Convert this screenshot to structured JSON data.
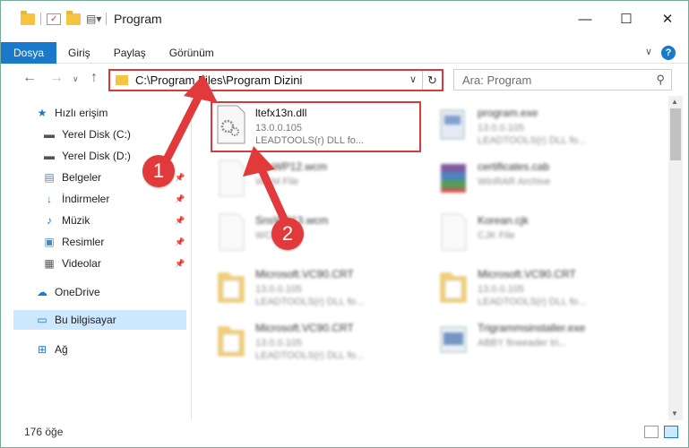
{
  "window": {
    "title": "Program",
    "controls": {
      "minimize": "—",
      "maximize": "☐",
      "close": "✕"
    }
  },
  "ribbon": {
    "tabs": [
      "Dosya",
      "Giriş",
      "Paylaş",
      "Görünüm"
    ],
    "help": "?"
  },
  "address": {
    "path": "C:\\Program Files\\Program Dizini",
    "search_placeholder": "Ara: Program"
  },
  "sidebar": {
    "items": [
      {
        "label": "Hızlı erişim",
        "icon": "star-icon"
      },
      {
        "label": "Yerel Disk (C:)",
        "icon": "drive-icon"
      },
      {
        "label": "Yerel Disk (D:)",
        "icon": "drive-icon"
      },
      {
        "label": "Belgeler",
        "icon": "documents-icon"
      },
      {
        "label": "İndirmeler",
        "icon": "download-icon"
      },
      {
        "label": "Müzik",
        "icon": "music-icon"
      },
      {
        "label": "Resimler",
        "icon": "pictures-icon"
      },
      {
        "label": "Videolar",
        "icon": "videos-icon"
      },
      {
        "label": "OneDrive",
        "icon": "cloud-icon"
      },
      {
        "label": "Bu bilgisayar",
        "icon": "computer-icon"
      },
      {
        "label": "Ağ",
        "icon": "network-icon"
      }
    ]
  },
  "files": [
    {
      "name": "ltefx13n.dll",
      "line2": "13.0.0.105",
      "line3": "LEADTOOLS(r) DLL fo..."
    },
    {
      "name": "program.exe",
      "line2": "13.0.0.105",
      "line3": "LEADTOOLS(r) DLL fo..."
    },
    {
      "name": "FileWP12.wcm",
      "line2": "WCM File",
      "line3": ""
    },
    {
      "name": "certificates.cab",
      "line2": "WinRAR Archive",
      "line3": ""
    },
    {
      "name": "SnsWP13.wcm",
      "line2": "WCM File",
      "line3": ""
    },
    {
      "name": "Korean.cjk",
      "line2": "CJK File",
      "line3": ""
    },
    {
      "name": "Microsoft.VC90.CRT",
      "line2": "13.0.0.105",
      "line3": "LEADTOOLS(r) DLL fo..."
    },
    {
      "name": "Microsoft.VC90.CRT",
      "line2": "13.0.0.105",
      "line3": "LEADTOOLS(r) DLL fo..."
    },
    {
      "name": "Microsoft.VC90.CRT",
      "line2": "13.0.0.105",
      "line3": "LEADTOOLS(r) DLL fo..."
    },
    {
      "name": "Trigrammsinstaller.exe",
      "line2": "ABBY fineeader tri...",
      "line3": ""
    }
  ],
  "status": {
    "count": "176 öğe"
  },
  "callouts": {
    "one": "1",
    "two": "2"
  },
  "colors": {
    "accent": "#1979ca",
    "highlight": "#d63a3a",
    "selection": "#cce8ff"
  }
}
